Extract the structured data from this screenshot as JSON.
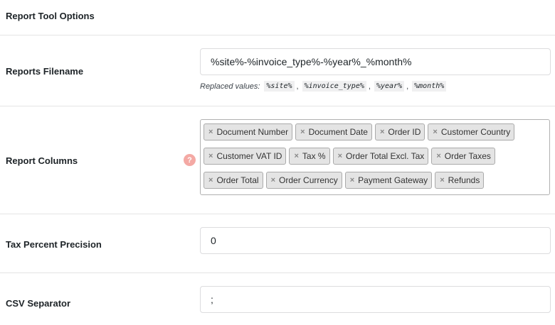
{
  "section": {
    "title": "Report Tool Options"
  },
  "filename": {
    "label": "Reports Filename",
    "value": "%site%-%invoice_type%-%year%_%month%",
    "hint_prefix": "Replaced values:",
    "codes": [
      "%site%",
      "%invoice_type%",
      "%year%",
      "%month%"
    ],
    "separator": ","
  },
  "columns": {
    "label": "Report Columns",
    "help_glyph": "?",
    "remove_glyph": "×",
    "tags": [
      "Document Number",
      "Document Date",
      "Order ID",
      "Customer Country",
      "Customer VAT ID",
      "Tax %",
      "Order Total Excl. Tax",
      "Order Taxes",
      "Order Total",
      "Order Currency",
      "Payment Gateway",
      "Refunds"
    ]
  },
  "precision": {
    "label": "Tax Percent Precision",
    "value": "0"
  },
  "csv": {
    "label": "CSV Separator",
    "value": ";"
  },
  "colors": {
    "help": "#f4a9a4",
    "tag_bg": "#e4e4e4",
    "divider": "#e4e4e4"
  }
}
